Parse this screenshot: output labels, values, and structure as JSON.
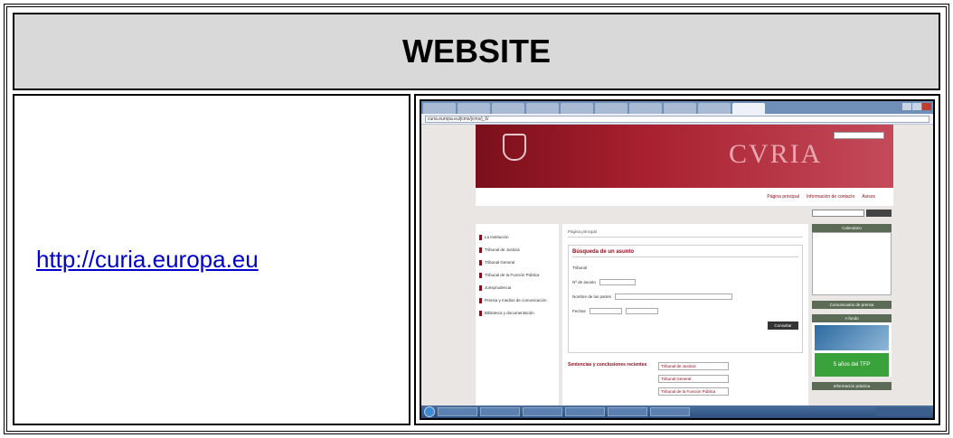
{
  "header": {
    "title": "WEBSITE"
  },
  "link": {
    "text": "http://curia.europa.eu"
  },
  "screenshot": {
    "url": "curia.europa.eu/jcms/jcms/j_6/",
    "banner_title": "CVRIA",
    "nav": [
      "Página principal",
      "Información de contacto",
      "Avisos"
    ],
    "left_menu": [
      "La Institución",
      "Tribunal de Justicia",
      "Tribunal General",
      "Tribunal de la Función Pública",
      "Jurisprudencia",
      "Prensa y medios de comunicación",
      "Biblioteca y documentación"
    ],
    "crumb": "Página principal",
    "search_title": "Búsqueda de un asunto",
    "search_labels": [
      "Tribunal",
      "Nº de asunto",
      "Nombre de las partes",
      "Fechas"
    ],
    "search_button": "Consultar",
    "recent_title": "Sentencias y conclusiones recientes",
    "recent_items": [
      "Tribunal de Justicia",
      "Tribunal General",
      "Tribunal de la Función Pública"
    ],
    "calendar_title": "Calendario",
    "press_title": "Comunicados de prensa",
    "events_title": "A fondo",
    "tfp_text": "5 años del TFP",
    "practical_title": "Información práctica"
  }
}
